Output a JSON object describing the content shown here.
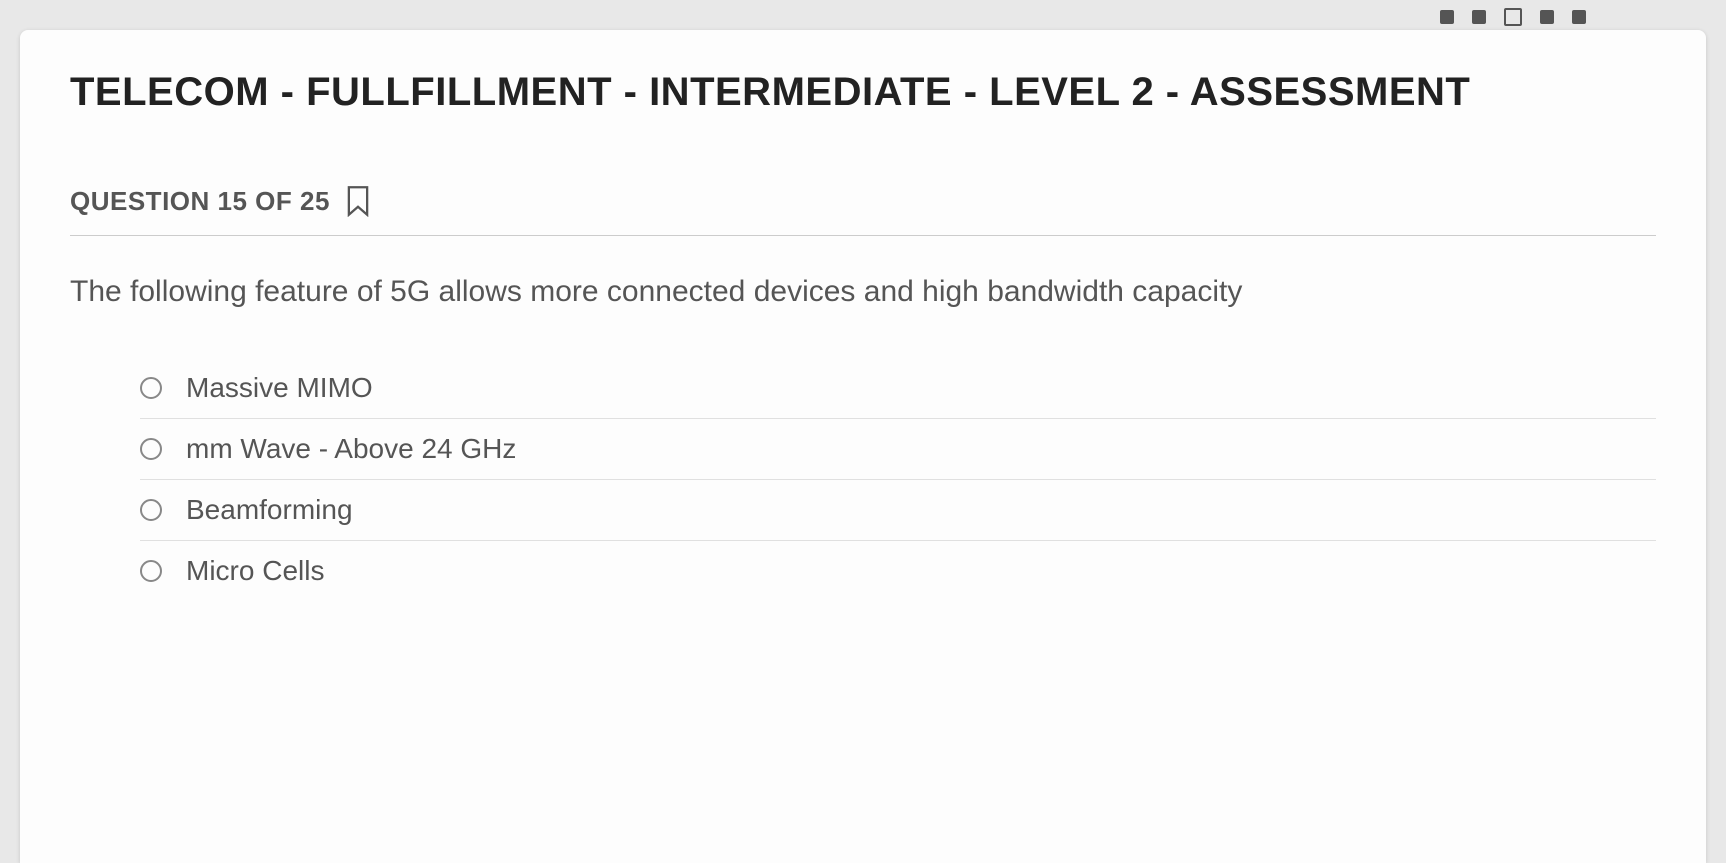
{
  "header": {
    "title": "TELECOM - FULLFILLMENT - INTERMEDIATE - LEVEL 2 - ASSESSMENT"
  },
  "question": {
    "counter": "QUESTION 15 OF 25",
    "text": "The following feature of 5G allows more connected devices and high bandwidth capacity",
    "options": [
      {
        "label": "Massive MIMO"
      },
      {
        "label": "mm Wave - Above 24 GHz"
      },
      {
        "label": "Beamforming"
      },
      {
        "label": "Micro Cells"
      }
    ]
  }
}
